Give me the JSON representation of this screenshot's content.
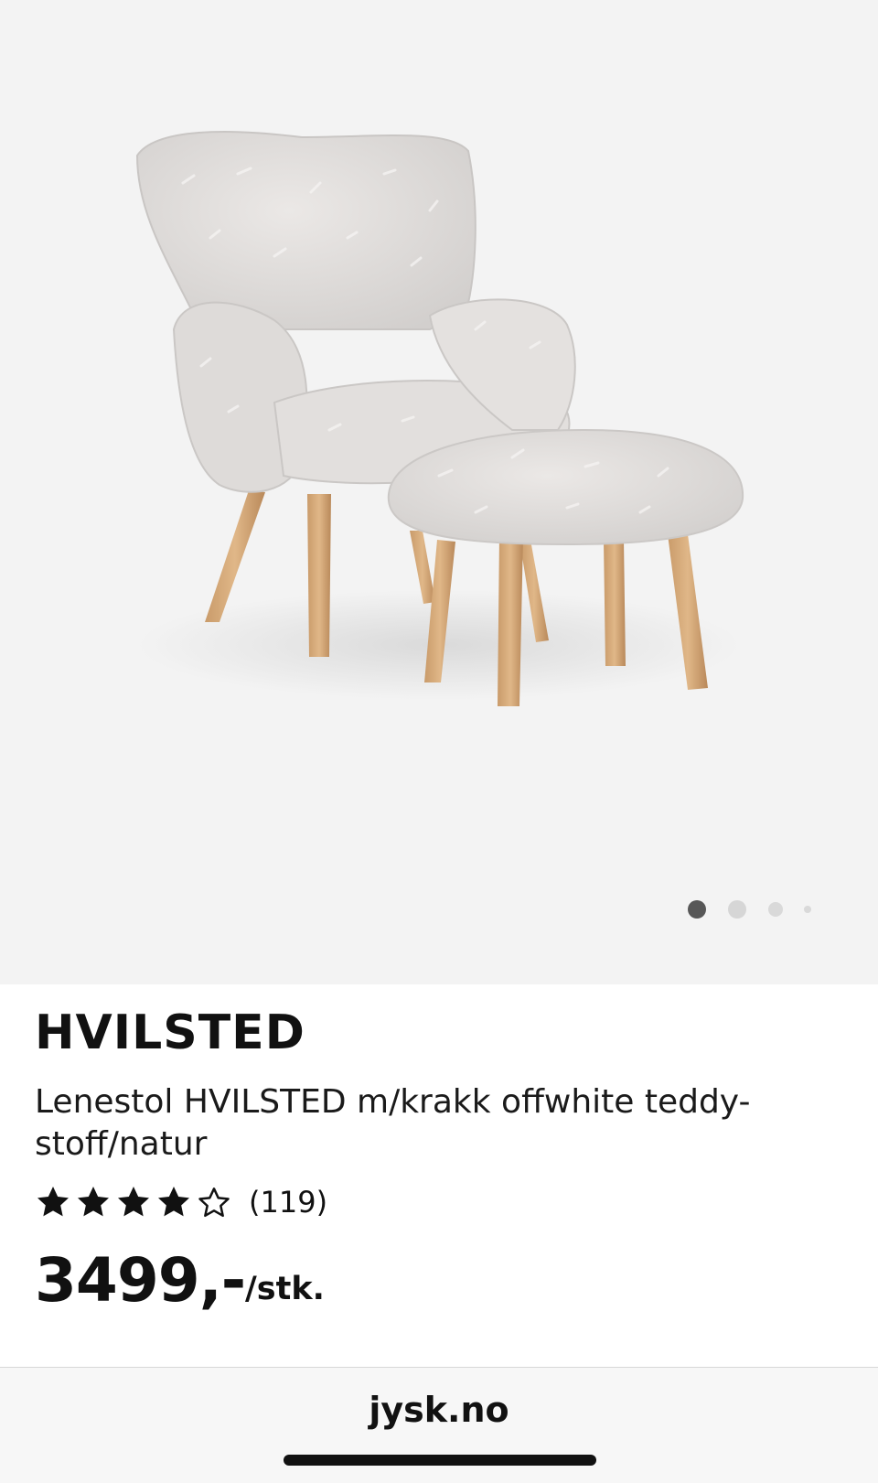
{
  "product": {
    "brand": "HVILSTED",
    "description": "Lenestol HVILSTED m/krakk offwhite teddy-stoff/natur",
    "rating": {
      "value": 4,
      "max": 5,
      "count_label": "(119)"
    },
    "price": "3499,-",
    "unit": "/stk."
  },
  "gallery": {
    "active_index": 0,
    "total": 4
  },
  "browser": {
    "url": "jysk.no"
  },
  "icons": {
    "star_filled": "star-filled-icon",
    "star_empty": "star-outline-icon"
  },
  "colors": {
    "text": "#111111",
    "hero_background": "#f3f3f3",
    "dot_active": "#575757",
    "dot_inactive": "#d6d6d6"
  }
}
